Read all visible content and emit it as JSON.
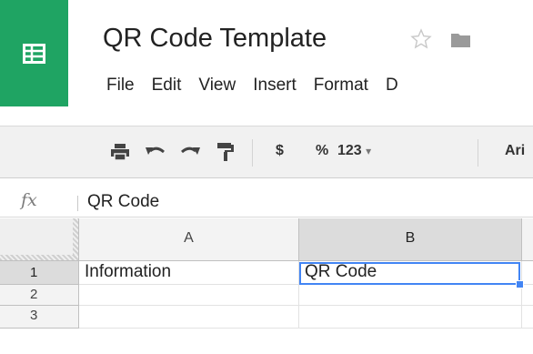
{
  "app": {
    "name": "Google Sheets",
    "brand_color": "#1fa463",
    "icon": "spreadsheet-icon"
  },
  "document": {
    "title": "QR Code Template",
    "star_icon": "star-icon",
    "folder_icon": "folder-icon"
  },
  "menu": {
    "items": [
      "File",
      "Edit",
      "View",
      "Insert",
      "Format",
      "D"
    ]
  },
  "toolbar": {
    "print_icon": "print-icon",
    "undo_icon": "undo-icon",
    "redo_icon": "redo-icon",
    "paint_format_icon": "paint-format-icon",
    "currency_label": "$",
    "percent_label": "%",
    "number_format_label": "123",
    "number_format_caret": "▾",
    "font_label": "Ari"
  },
  "formula_bar": {
    "fx_label": "fx",
    "value": "QR Code"
  },
  "grid": {
    "columns": [
      "A",
      "B"
    ],
    "rows": [
      {
        "number": "1",
        "cells": [
          "Information",
          "QR Code"
        ]
      },
      {
        "number": "2",
        "cells": [
          "",
          ""
        ]
      },
      {
        "number": "3",
        "cells": [
          "",
          ""
        ]
      }
    ],
    "selected_cell": "B1",
    "selection_color": "#4285f4"
  }
}
